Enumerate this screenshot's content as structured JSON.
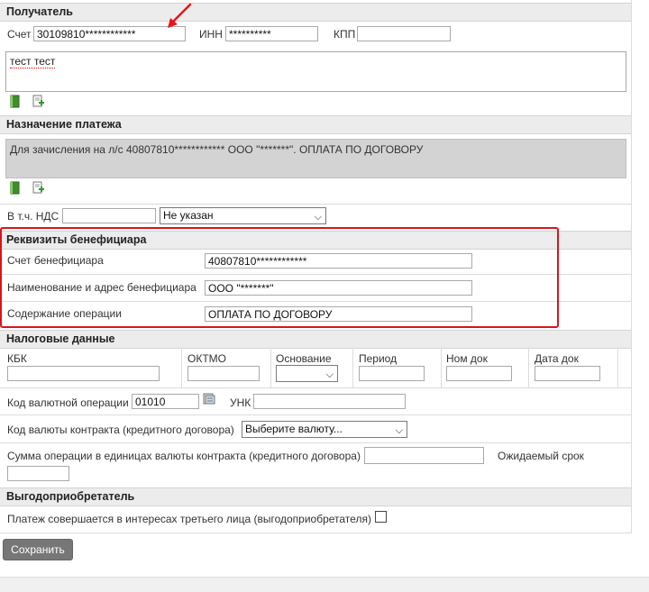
{
  "recipient": {
    "section_title": "Получатель",
    "account_label": "Счет",
    "account_value": "30109810************",
    "inn_label": "ИНН",
    "inn_value": "**********",
    "kpp_label": "КПП",
    "kpp_value": "",
    "name_text": "тест тест"
  },
  "purpose": {
    "section_title": "Назначение платежа",
    "text": "Для зачисления на л/с 40807810************ ООО \"*******\". ОПЛАТА ПО ДОГОВОРУ"
  },
  "vat": {
    "label": "В т.ч. НДС",
    "value": "",
    "select_value": "Не указан"
  },
  "beneficiary": {
    "section_title": "Реквизиты бенефициара",
    "account_label": "Счет бенефициара",
    "account_value": "40807810************",
    "name_label": "Наименование и адрес бенефициара",
    "name_value": "ООО \"*******\"",
    "operation_label": "Содержание операции",
    "operation_value": "ОПЛАТА ПО ДОГОВОРУ"
  },
  "tax": {
    "section_title": "Налоговые данные",
    "kbk_label": "КБК",
    "oktmo_label": "ОКТМО",
    "basis_label": "Основание",
    "period_label": "Период",
    "doc_num_label": "Ном док",
    "doc_date_label": "Дата док"
  },
  "currency": {
    "op_code_label": "Код валютной операции",
    "op_code_value": "01010",
    "unk_label": "УНК",
    "unk_value": "",
    "contract_currency_label": "Код валюты контракта (кредитного договора)",
    "contract_currency_value": "Выберите валюту...",
    "amount_label": "Сумма операции в единицах валюты контракта (кредитного договора)",
    "expected_term_label": "Ожидаемый срок"
  },
  "beneficiary_owner": {
    "section_title": "Выгодоприобретатель",
    "third_party_label": "Платеж совершается в интересах третьего лица (выгодоприобретателя)"
  },
  "actions": {
    "save_label": "Сохранить"
  },
  "colors": {
    "highlight_border": "#d9141c",
    "arrow": "#e8141c",
    "section_bg": "#ececec",
    "button_bg": "#777777"
  }
}
